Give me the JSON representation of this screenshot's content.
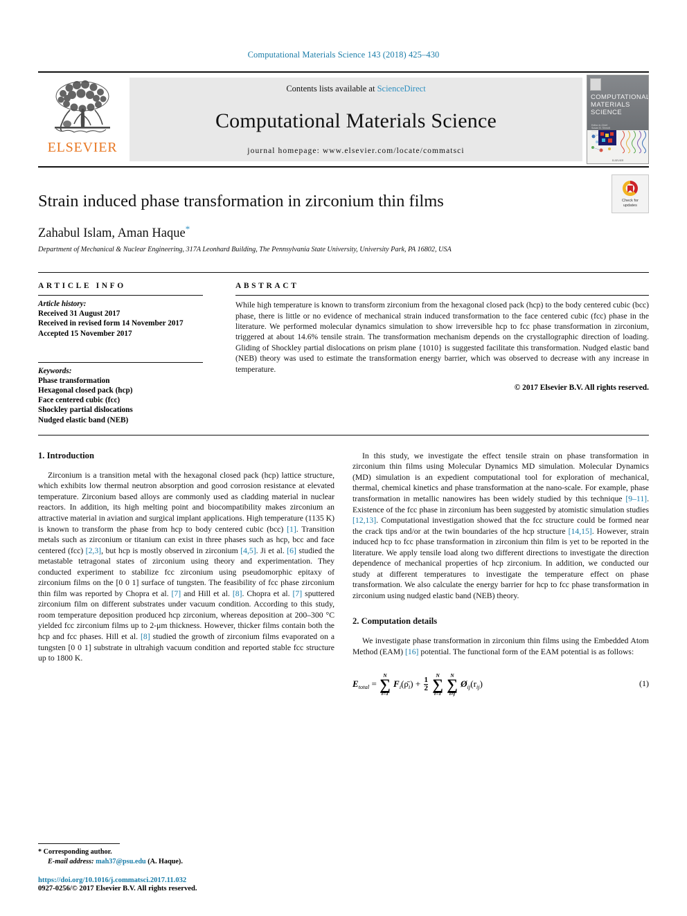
{
  "running_head": "Computational Materials Science 143 (2018) 425–430",
  "masthead": {
    "publisher_name": "ELSEVIER",
    "contents_prefix": "Contents lists available at ",
    "sciencedirect": "ScienceDirect",
    "journal_title": "Computational Materials Science",
    "homepage": "journal homepage: www.elsevier.com/locate/commatsci",
    "cover": {
      "title_line1": "COMPUTATIONAL",
      "title_line2": "MATERIALS",
      "title_line3": "SCIENCE",
      "footer": "ELSEVIER"
    }
  },
  "article": {
    "title": "Strain induced phase transformation in zirconium thin films",
    "authors": "Zahabul Islam, Aman Haque",
    "author_star": "*",
    "affiliation": "Department of Mechanical & Nuclear Engineering, 317A Leonhard Building, The Pennsylvania State University, University Park, PA 16802, USA",
    "crossmark_line1": "Check for",
    "crossmark_line2": "updates"
  },
  "info": {
    "heading": "ARTICLE INFO",
    "history_label": "Article history:",
    "history": [
      "Received 31 August 2017",
      "Received in revised form 14 November 2017",
      "Accepted 15 November 2017"
    ],
    "keywords_label": "Keywords:",
    "keywords": [
      "Phase transformation",
      "Hexagonal closed pack (hcp)",
      "Face centered cubic (fcc)",
      "Shockley partial dislocations",
      "Nudged elastic band (NEB)"
    ]
  },
  "abstract": {
    "heading": "ABSTRACT",
    "text": "While high temperature is known to transform zirconium from the hexagonal closed pack (hcp) to the body centered cubic (bcc) phase, there is little or no evidence of mechanical strain induced transformation to the face centered cubic (fcc) phase in the literature. We performed molecular dynamics simulation to show irreversible hcp to fcc phase transformation in zirconium, triggered at about 14.6% tensile strain. The transformation mechanism depends on the crystallographic direction of loading. Gliding of Shockley partial dislocations on prism plane {1010} is suggested facilitate this transformation. Nudged elastic band (NEB) theory was used to estimate the transformation energy barrier, which was observed to decrease with any increase in temperature.",
    "copyright": "© 2017 Elsevier B.V. All rights reserved."
  },
  "sections": {
    "intro_heading": "1. Introduction",
    "intro_p1_a": "Zirconium is a transition metal with the hexagonal closed pack (hcp) lattice structure, which exhibits low thermal neutron absorption and good corrosion resistance at elevated temperature. Zirconium based alloys are commonly used as cladding material in nuclear reactors. In addition, its high melting point and biocompatibility makes zirconium an attractive material in aviation and surgical implant applications. High temperature (1135 K) is known to transform the phase from hcp to body centered cubic (bcc) ",
    "intro_ref1": "[1]",
    "intro_p1_b": ". Transition metals such as zirconium or titanium can exist in three phases such as hcp, bcc and face centered (fcc) ",
    "intro_ref2": "[2,3]",
    "intro_p1_c": ", but hcp is mostly observed in zirconium ",
    "intro_ref3": "[4,5]",
    "intro_p1_d": ". Ji et al. ",
    "intro_ref4": "[6]",
    "intro_p1_e": " studied the metastable tetragonal states of zirconium using theory and experimentation. They conducted experiment to stabilize fcc zirconium using pseudomorphic epitaxy of zirconium films on the [0 0 1] surface of tungsten. The feasibility of fcc phase zirconium thin film was reported by Chopra et al. ",
    "intro_ref5": "[7]",
    "intro_p1_f": " and Hill et al. ",
    "intro_ref6": "[8]",
    "intro_p1_g": ". Chopra et al. ",
    "intro_ref7": "[7]",
    "intro_p1_h": " sputtered zirconium film on different substrates under vacuum condition. According to this study, room temperature deposition produced hcp zirconium, whereas deposition at 200–300 °C yielded fcc zirconium films up to 2-μm thickness. However, thicker films contain both the hcp and fcc phases. Hill et al. ",
    "intro_ref8": "[8]",
    "intro_p1_i": " studied the growth of zirconium films evaporated on a tungsten [0 0 1] substrate in ultrahigh vacuum condition and reported stable fcc structure up to 1800 K.",
    "intro_p2_a": "In this study, we investigate the effect tensile strain on phase transformation in zirconium thin films using Molecular Dynamics MD simulation. Molecular Dynamics (MD) simulation is an expedient computational tool for exploration of mechanical, thermal, chemical kinetics and phase transformation at the nano-scale. For example, phase transformation in metallic nanowires has been widely studied by this technique ",
    "intro_p2_ref1": "[9–11]",
    "intro_p2_b": ". Existence of the fcc phase in zirconium has been suggested by atomistic simulation studies ",
    "intro_p2_ref2": "[12,13]",
    "intro_p2_c": ". Computational investigation showed that the fcc structure could be formed near the crack tips and/or at the twin boundaries of the hcp structure ",
    "intro_p2_ref3": "[14,15]",
    "intro_p2_d": ". However, strain induced hcp to fcc phase transformation in zirconium thin film is yet to be reported in the literature. We apply tensile load along two different directions to investigate the direction dependence of mechanical properties of hcp zirconium. In addition, we conducted our study at different temperatures to investigate the temperature effect on phase transformation. We also calculate the energy barrier for hcp to fcc phase transformation in zirconium using nudged elastic band (NEB) theory.",
    "computation_heading": "2. Computation details",
    "comp_p1_a": "We investigate phase transformation in zirconium thin films using the Embedded Atom Method (EAM) ",
    "comp_ref1": "[16]",
    "comp_p1_b": " potential. The functional form of the EAM potential is as follows:"
  },
  "equation": {
    "lhs": "E",
    "lhs_sub": "total",
    "equals": "=",
    "sum1_upper": "N",
    "sum1_lower": "i=1",
    "term1": "F",
    "term1_sub": "i",
    "term1_arg": "(ρ̄",
    "term1_arg_sub": "i",
    "term1_close": ")",
    "plus": "+",
    "frac_num": "1",
    "frac_den": "2",
    "sum2_upper": "N",
    "sum2_lower": "i=1",
    "sum3_upper": "N",
    "sum3_lower": "i≠j",
    "term2": "Ø",
    "term2_sub": "ij",
    "term2_arg": "(r",
    "term2_arg_sub": "ij",
    "term2_close": ")",
    "number": "(1)"
  },
  "footnote": {
    "corresponding": "* Corresponding author.",
    "email_label": "E-mail address:",
    "email": "mah37@psu.edu",
    "email_suffix": " (A. Haque).",
    "doi": "https://doi.org/10.1016/j.commatsci.2017.11.032",
    "issn": "0927-0256/© 2017 Elsevier B.V. All rights reserved."
  },
  "colors": {
    "link": "#1a7ca8",
    "elsevier_orange": "#E87722",
    "sciencedirect": "#2e8fc0"
  }
}
